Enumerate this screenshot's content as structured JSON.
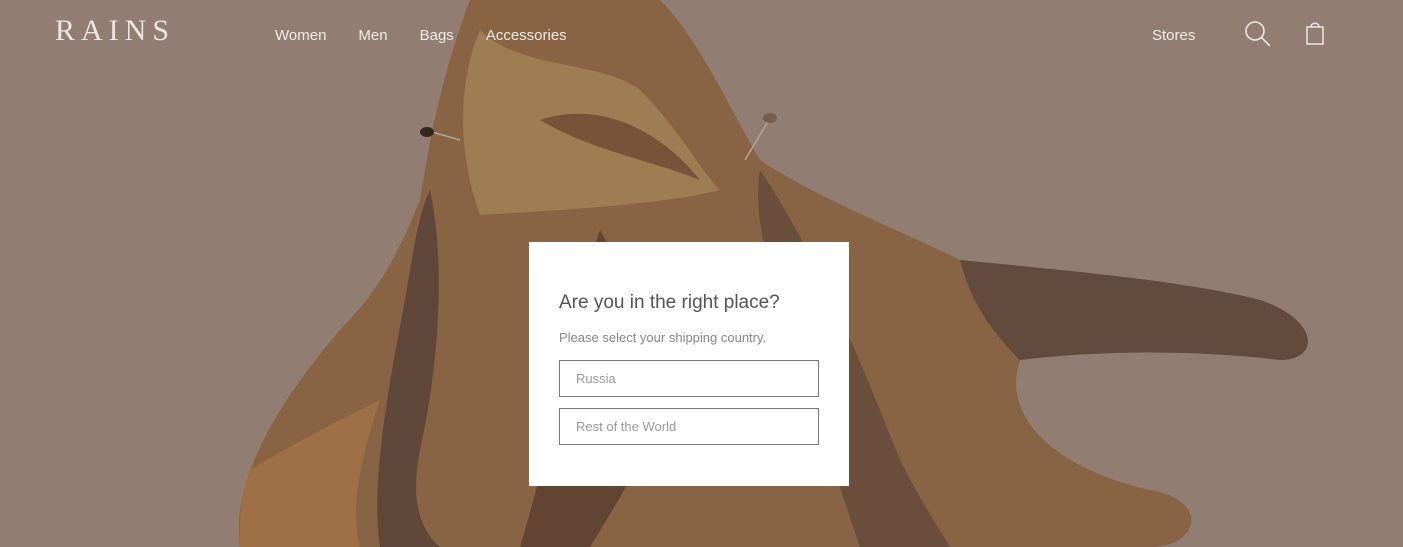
{
  "header": {
    "logo": "RAINS",
    "nav": [
      "Women",
      "Men",
      "Bags",
      "Accessories"
    ],
    "stores_label": "Stores",
    "icons": {
      "search": "search-icon",
      "bag": "shopping-bag-icon"
    }
  },
  "hero": {
    "background_color": "#b09a90",
    "garment_color": "#b07a45"
  },
  "modal": {
    "title": "Are you in the right place?",
    "subtitle": "Please select your shipping country.",
    "options": [
      "Russia",
      "Rest of the World"
    ]
  }
}
